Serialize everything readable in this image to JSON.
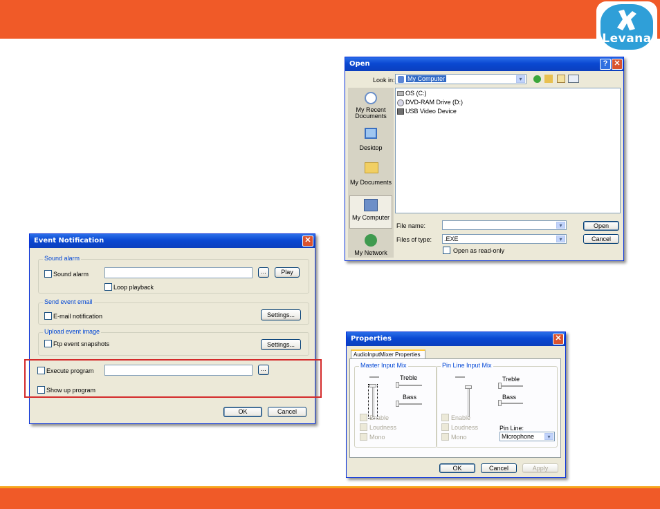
{
  "slide": {
    "logo_text": "Levana",
    "colors": {
      "bar": "#f05a28",
      "stripe": "#f6a51d",
      "logo_blue": "#2f9fd8",
      "highlight": "#d42a2a"
    }
  },
  "open_dialog": {
    "title": "Open",
    "help_glyph": "?",
    "close_glyph": "✕",
    "look_in_label": "Look in:",
    "look_in_value": "My Computer",
    "places": [
      {
        "label": "My Recent Documents",
        "icon": "recent-documents-icon"
      },
      {
        "label": "Desktop",
        "icon": "desktop-icon"
      },
      {
        "label": "My Documents",
        "icon": "my-documents-icon"
      },
      {
        "label": "My Computer",
        "icon": "my-computer-icon"
      },
      {
        "label": "My Network",
        "icon": "my-network-icon"
      }
    ],
    "files": [
      {
        "name": "OS (C:)",
        "icon": "hard-drive-icon"
      },
      {
        "name": "DVD-RAM Drive (D:)",
        "icon": "dvd-drive-icon"
      },
      {
        "name": "USB Video Device",
        "icon": "usb-video-icon"
      }
    ],
    "file_name_label": "File name:",
    "file_name_value": "",
    "files_of_type_label": "Files of type:",
    "files_of_type_value": ".EXE",
    "read_only_label": "Open as read-only",
    "open_button": "Open",
    "cancel_button": "Cancel",
    "dropdown_glyph": "▾"
  },
  "event_dialog": {
    "title": "Event Notification",
    "close_glyph": "✕",
    "sound_group": "Sound alarm",
    "sound_checkbox": "Sound alarm",
    "browse": "...",
    "play": "Play",
    "loop": "Loop playback",
    "email_group": "Send event email",
    "email_checkbox": "E-mail notification",
    "settings": "Settings...",
    "upload_group": "Upload event image",
    "ftp_checkbox": "Ftp event snapshots",
    "execute_checkbox": "Execute program",
    "show_checkbox": "Show up program",
    "ok": "OK",
    "cancel": "Cancel"
  },
  "props_dialog": {
    "title": "Properties",
    "close_glyph": "✕",
    "tab": "AudioInputMixer Properties",
    "master_group": "Master Input Mix",
    "pin_group": "Pin Line Input Mix",
    "treble": "Treble",
    "bass": "Bass",
    "enable": "Enable",
    "loudness": "Loudness",
    "mono": "Mono",
    "pin_line_label": "Pin Line:",
    "pin_line_value": "Microphone",
    "dropdown_glyph": "▾",
    "ok": "OK",
    "cancel": "Cancel",
    "apply": "Apply"
  }
}
